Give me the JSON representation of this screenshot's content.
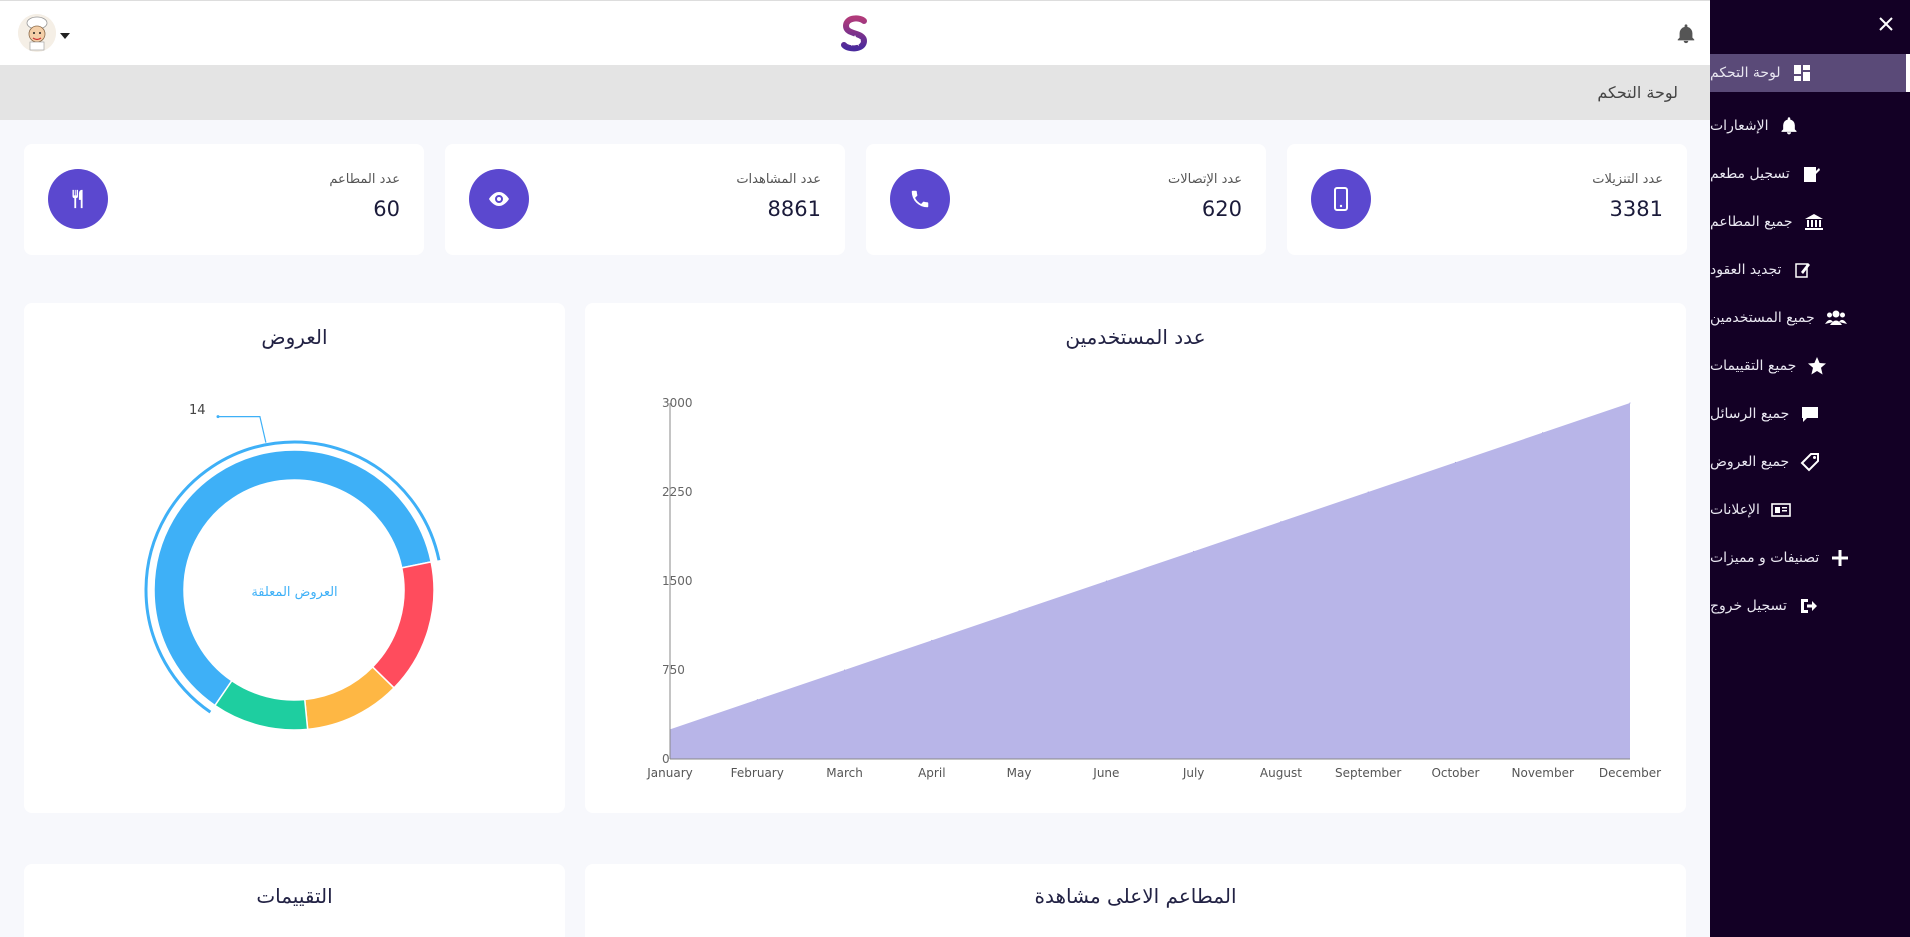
{
  "header": {
    "breadcrumb": "لوحة التحكم"
  },
  "sidebar": {
    "items": [
      {
        "label": "لوحة التحكم",
        "icon": "dashboard-icon"
      },
      {
        "label": "الإشعارات",
        "icon": "bell-icon"
      },
      {
        "label": "تسجيل مطعم",
        "icon": "register-icon"
      },
      {
        "label": "جميع المطاعم",
        "icon": "bank-icon"
      },
      {
        "label": "تجديد العقود",
        "icon": "edit-icon"
      },
      {
        "label": "جميع المستخدمين",
        "icon": "users-icon"
      },
      {
        "label": "جميع التقييمات",
        "icon": "star-icon"
      },
      {
        "label": "جميع الرسائل",
        "icon": "message-icon"
      },
      {
        "label": "جميع العروض",
        "icon": "tag-icon"
      },
      {
        "label": "الإعلانات",
        "icon": "ads-icon"
      },
      {
        "label": "تصنيفات و مميزات",
        "icon": "plus-icon"
      },
      {
        "label": "تسجيل خروج",
        "icon": "logout-icon"
      }
    ]
  },
  "stats": [
    {
      "label": "عدد التنزيلات",
      "value": "3381",
      "icon": "phone-icon"
    },
    {
      "label": "عدد الإتصالات",
      "value": "620",
      "icon": "call-icon"
    },
    {
      "label": "عدد المشاهدات",
      "value": "8861",
      "icon": "eye-icon"
    },
    {
      "label": "عدد المطاعم",
      "value": "60",
      "icon": "cutlery-icon"
    }
  ],
  "panels": {
    "users_title": "عدد المستخدمين",
    "offers_title": "العروض",
    "offers_center": "العروض المعلقة",
    "offers_callout": "14",
    "ratings_title": "التقييمات",
    "top_viewed_title": "المطاعم الاعلى مشاهدة"
  },
  "chart_data": [
    {
      "type": "area",
      "title": "عدد المستخدمين",
      "x": [
        "January",
        "February",
        "March",
        "April",
        "May",
        "June",
        "July",
        "August",
        "September",
        "October",
        "November",
        "December"
      ],
      "y_ticks": [
        0,
        750,
        1500,
        2250,
        3000
      ],
      "ylim": [
        0,
        3000
      ],
      "series": [
        {
          "values": [
            250,
            500,
            750,
            1000,
            1250,
            1500,
            1750,
            2000,
            2250,
            2500,
            2750,
            3000
          ],
          "color": "#b8b5e8"
        }
      ]
    },
    {
      "type": "pie",
      "title": "العروض",
      "center_label": "العروض المعلقة",
      "slices": [
        {
          "value": 14,
          "color": "#3eb0f7",
          "label": "العروض المعلقة"
        },
        {
          "value": 3.5,
          "color": "#ff4c5d"
        },
        {
          "value": 2.5,
          "color": "#feb744"
        },
        {
          "value": 2.5,
          "color": "#1ecea0"
        }
      ],
      "callout": "14"
    }
  ]
}
